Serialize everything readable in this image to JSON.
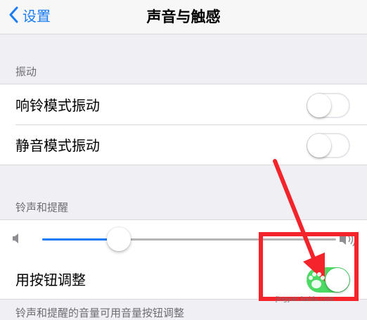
{
  "navbar": {
    "back_label": "设置",
    "title": "声音与触感"
  },
  "vibration": {
    "header": "振动",
    "rows": [
      {
        "label": "响铃模式振动",
        "on": false
      },
      {
        "label": "静音模式振动",
        "on": false
      }
    ]
  },
  "ringer": {
    "header": "铃声和提醒",
    "volume_level": 0.26,
    "button_adjust": {
      "label": "用按钮调整",
      "on": true
    }
  },
  "footer_text": "铃声和提醒的音量可用音量按钮调整",
  "watermark": {
    "logo": "Baidu",
    "url": "jingyan.baidu.com"
  },
  "colors": {
    "accent": "#1a7cf7",
    "toggle_on": "#4cd964",
    "annotation": "#f5242b"
  }
}
